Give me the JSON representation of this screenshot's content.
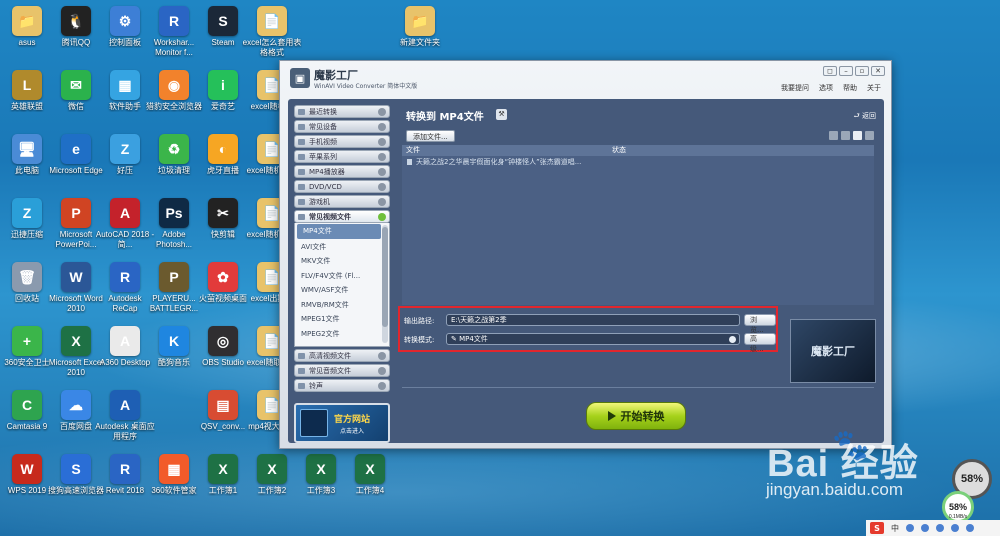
{
  "desktop": {
    "icons": [
      {
        "label": "asus",
        "glyph": "📁",
        "color": "#e8c36a"
      },
      {
        "label": "腾讯QQ",
        "glyph": "🐧",
        "color": "#222"
      },
      {
        "label": "控制面板",
        "glyph": "⚙",
        "color": "#3d7fd6"
      },
      {
        "label": "Workshar... Monitor f...",
        "glyph": "R",
        "color": "#2a65c4"
      },
      {
        "label": "Steam",
        "glyph": "S",
        "color": "#1b2838"
      },
      {
        "label": "excel怎么套用表格格式",
        "glyph": "📄",
        "color": "#e8c36a"
      },
      {
        "label": "新建文件夹",
        "glyph": "📁",
        "color": "#e8c36a"
      },
      {
        "label": "英雄联盟",
        "glyph": "L",
        "color": "#b08a2c"
      },
      {
        "label": "微信",
        "glyph": "✉",
        "color": "#2bb24c"
      },
      {
        "label": "软件助手",
        "glyph": "▦",
        "color": "#35a4e2"
      },
      {
        "label": "猎豹安全浏览器",
        "glyph": "◉",
        "color": "#f2822c"
      },
      {
        "label": "爱奇艺",
        "glyph": "i",
        "color": "#25c05a"
      },
      {
        "label": "excel随机列",
        "glyph": "📄",
        "color": "#e8c36a"
      },
      {
        "label": "此电脑",
        "glyph": "🖥",
        "color": "#4a8bd6"
      },
      {
        "label": "Microsoft Edge",
        "glyph": "e",
        "color": "#1f6fc6"
      },
      {
        "label": "好压",
        "glyph": "Z",
        "color": "#3ba0e0"
      },
      {
        "label": "垃圾清理",
        "glyph": "♻",
        "color": "#3bb54a"
      },
      {
        "label": "虎牙直播",
        "glyph": "◐",
        "color": "#f6a623"
      },
      {
        "label": "excel随机生成",
        "glyph": "📄",
        "color": "#e8c36a"
      },
      {
        "label": "迅捷压缩",
        "glyph": "Z",
        "color": "#2a9fd8"
      },
      {
        "label": "Microsoft PowerPoi...",
        "glyph": "P",
        "color": "#d04423"
      },
      {
        "label": "AutoCAD 2018 - 简...",
        "glyph": "A",
        "color": "#c4222b"
      },
      {
        "label": "Adobe Photosh...",
        "glyph": "Ps",
        "color": "#0f2a45"
      },
      {
        "label": "快剪辑",
        "glyph": "✂",
        "color": "#222"
      },
      {
        "label": "excel随机成小",
        "glyph": "📄",
        "color": "#e8c36a"
      },
      {
        "label": "回收站",
        "glyph": "🗑",
        "color": "#8a9aae"
      },
      {
        "label": "Microsoft Word 2010",
        "glyph": "W",
        "color": "#2b5797"
      },
      {
        "label": "Autodesk ReCap",
        "glyph": "R",
        "color": "#2a65c4"
      },
      {
        "label": "PLAYERU... BATTLEGR...",
        "glyph": "P",
        "color": "#6b5a2e"
      },
      {
        "label": "火萤视频桌面",
        "glyph": "✿",
        "color": "#e23b3b"
      },
      {
        "label": "excel出期算",
        "glyph": "📄",
        "color": "#e8c36a"
      },
      {
        "label": "360安全卫士",
        "glyph": "+",
        "color": "#3bb54a"
      },
      {
        "label": "Microsoft Excel 2010",
        "glyph": "X",
        "color": "#1e7145"
      },
      {
        "label": "A360 Desktop",
        "glyph": "A",
        "color": "#eaeaea"
      },
      {
        "label": "酷狗音乐",
        "glyph": "K",
        "color": "#1f86e0"
      },
      {
        "label": "OBS Studio",
        "glyph": "◎",
        "color": "#302e31"
      },
      {
        "label": "excel随取人名",
        "glyph": "📄",
        "color": "#e8c36a"
      },
      {
        "label": "Camtasia 9",
        "glyph": "C",
        "color": "#2ea44f"
      },
      {
        "label": "百度网盘",
        "glyph": "☁",
        "color": "#3a87e6"
      },
      {
        "label": "Autodesk 桌面应用程序",
        "glyph": "A",
        "color": "#1e5fb4"
      },
      {
        "label": "QSV_conv...",
        "glyph": "▤",
        "color": "#d84c32"
      },
      {
        "label": "mp4视大怎么",
        "glyph": "📄",
        "color": "#e8c36a"
      },
      {
        "label": "WPS 2019",
        "glyph": "W",
        "color": "#c72a1c"
      },
      {
        "label": "搜狗高速浏览器",
        "glyph": "S",
        "color": "#2a6ed6"
      },
      {
        "label": "Revit 2018",
        "glyph": "R",
        "color": "#2a65c4"
      },
      {
        "label": "360软件管家",
        "glyph": "▦",
        "color": "#f25b2a"
      },
      {
        "label": "工作簿1",
        "glyph": "X",
        "color": "#1e7145"
      },
      {
        "label": "工作簿2",
        "glyph": "X",
        "color": "#1e7145"
      },
      {
        "label": "工作簿3",
        "glyph": "X",
        "color": "#1e7145"
      },
      {
        "label": "工作簿4",
        "glyph": "X",
        "color": "#1e7145"
      }
    ]
  },
  "window": {
    "title": "魔影工厂",
    "subtitle": "WinAVI Video Converter 简体中文版",
    "controls": [
      "◻",
      "–",
      "▫",
      "✕"
    ],
    "menu": [
      "我要提问",
      "选项",
      "帮助",
      "关于"
    ],
    "sidebar": {
      "categories": [
        {
          "label": "最近转换",
          "open": false
        },
        {
          "label": "常见设备",
          "open": false
        },
        {
          "label": "手机视频",
          "open": false
        },
        {
          "label": "苹果系列",
          "open": false
        },
        {
          "label": "MP4播放器",
          "open": false
        },
        {
          "label": "DVD/VCD",
          "open": false
        },
        {
          "label": "游戏机",
          "open": false
        },
        {
          "label": "常见视频文件",
          "open": true
        }
      ],
      "formats": [
        "MP4文件",
        "AVI文件",
        "MKV文件",
        "FLV/F4V文件 (Fl...",
        "WMV/ASF文件",
        "RMVB/RM文件",
        "MPEG1文件",
        "MPEG2文件"
      ],
      "selected_format": "MP4文件",
      "categories_bottom": [
        "高清视频文件",
        "常见音频文件",
        "铃声"
      ],
      "official_site": "官方网站",
      "official_sub": "点击进入"
    },
    "main": {
      "convert_title": "转换到 MP4文件",
      "tool_icon": "⚒",
      "back_label": "返回",
      "add_file_label": "添加文件...",
      "columns": [
        "文件",
        "状态"
      ],
      "files": [
        "天籁之战2之华晨宇假面化身“钟楼怪人”张杰霸道唱..."
      ],
      "output_path_label": "输出路径:",
      "output_path_value": "E:\\天籁之战第2季",
      "browse_label": "浏览...",
      "mode_label": "转换模式:",
      "mode_value": "MP4文件",
      "advanced_label": "高级...",
      "preview_text": "魔影工厂",
      "start_label": "开始转换"
    }
  },
  "watermark": {
    "brand": "Bai  经验",
    "url": "jingyan.baidu.com"
  },
  "system": {
    "gauge1": "58%",
    "gauge2": "58%",
    "gauge2_sub": "0.1MB/s",
    "ime": "S",
    "ime_lang": "中"
  }
}
